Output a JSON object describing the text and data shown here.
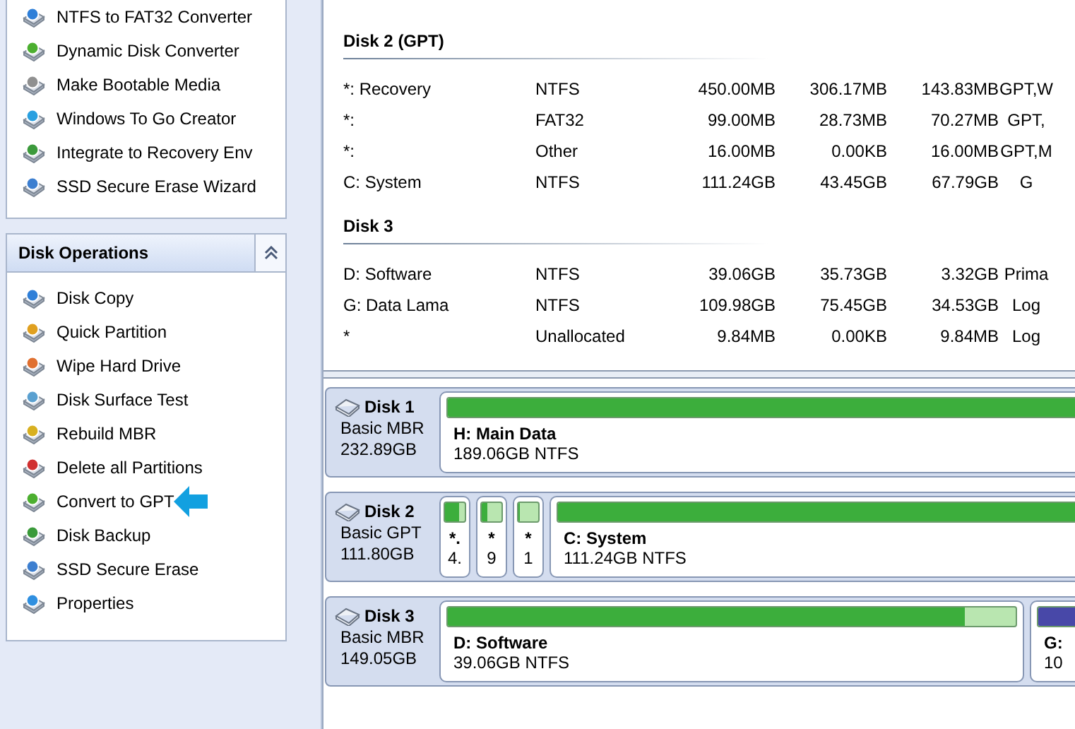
{
  "sidebar": {
    "tools": [
      {
        "label": "NTFS to FAT32 Converter"
      },
      {
        "label": "Dynamic Disk Converter"
      },
      {
        "label": "Make Bootable Media"
      },
      {
        "label": "Windows To Go Creator"
      },
      {
        "label": "Integrate to Recovery Env"
      },
      {
        "label": "SSD Secure Erase Wizard"
      }
    ],
    "disk_operations": {
      "title": "Disk Operations",
      "expanded": true,
      "items": [
        {
          "label": "Disk Copy",
          "pointer": false
        },
        {
          "label": "Quick Partition",
          "pointer": false
        },
        {
          "label": "Wipe Hard Drive",
          "pointer": false
        },
        {
          "label": "Disk Surface Test",
          "pointer": false
        },
        {
          "label": "Rebuild MBR",
          "pointer": false
        },
        {
          "label": "Delete all Partitions",
          "pointer": false
        },
        {
          "label": "Convert to GPT",
          "pointer": true
        },
        {
          "label": "Disk Backup",
          "pointer": false
        },
        {
          "label": "SSD Secure Erase",
          "pointer": false
        },
        {
          "label": "Properties",
          "pointer": false
        }
      ]
    }
  },
  "partition_list": {
    "groups": [
      {
        "title": "Disk 2 (GPT)",
        "rows": [
          {
            "partition": "*: Recovery",
            "file_system": "NTFS",
            "capacity": "450.00MB",
            "used": "306.17MB",
            "unused": "143.83MB",
            "type": "GPT,W"
          },
          {
            "partition": "*:",
            "file_system": "FAT32",
            "capacity": "99.00MB",
            "used": "28.73MB",
            "unused": "70.27MB",
            "type": "GPT,"
          },
          {
            "partition": "*:",
            "file_system": "Other",
            "capacity": "16.00MB",
            "used": "0.00KB",
            "unused": "16.00MB",
            "type": "GPT,M"
          },
          {
            "partition": "C: System",
            "file_system": "NTFS",
            "capacity": "111.24GB",
            "used": "43.45GB",
            "unused": "67.79GB",
            "type": "G"
          }
        ]
      },
      {
        "title": "Disk 3",
        "rows": [
          {
            "partition": "D: Software",
            "file_system": "NTFS",
            "capacity": "39.06GB",
            "used": "35.73GB",
            "unused": "3.32GB",
            "type": "Prima"
          },
          {
            "partition": "G: Data Lama",
            "file_system": "NTFS",
            "capacity": "109.98GB",
            "used": "75.45GB",
            "unused": "34.53GB",
            "type": "Log"
          },
          {
            "partition": "*",
            "file_system": "Unallocated",
            "capacity": "9.84MB",
            "used": "0.00KB",
            "unused": "9.84MB",
            "type": "Log"
          }
        ]
      }
    ]
  },
  "disk_map": [
    {
      "name": "Disk 1",
      "style": "Basic MBR",
      "size": "232.89GB",
      "partitions": [
        {
          "kind": "wide",
          "label": "H: Main Data",
          "detail": "189.06GB NTFS",
          "level": 1,
          "color": "#3cae3c"
        }
      ]
    },
    {
      "name": "Disk 2",
      "style": "Basic GPT",
      "size": "111.80GB",
      "partitions": [
        {
          "kind": "narrow",
          "label": "*.",
          "detail": "4.",
          "level": 0.68,
          "color": "#3cae3c"
        },
        {
          "kind": "narrow",
          "label": "*",
          "detail": "9",
          "level": 0.29,
          "color": "#3cae3c"
        },
        {
          "kind": "narrow",
          "label": "*",
          "detail": "1",
          "level": 0.1,
          "color": "#3cae3c"
        },
        {
          "kind": "wide",
          "label": "C: System",
          "detail": "111.24GB NTFS",
          "level": 1,
          "color": "#3cae3c"
        }
      ]
    },
    {
      "name": "Disk 3",
      "style": "Basic MBR",
      "size": "149.05GB",
      "partitions": [
        {
          "kind": "fixed",
          "label": "D: Software",
          "detail": "39.06GB NTFS",
          "level": 0.91,
          "color": "#3cae3c"
        },
        {
          "kind": "cut",
          "label": "G:",
          "detail": "10",
          "level": 1,
          "color": "#4848a8"
        }
      ]
    }
  ]
}
